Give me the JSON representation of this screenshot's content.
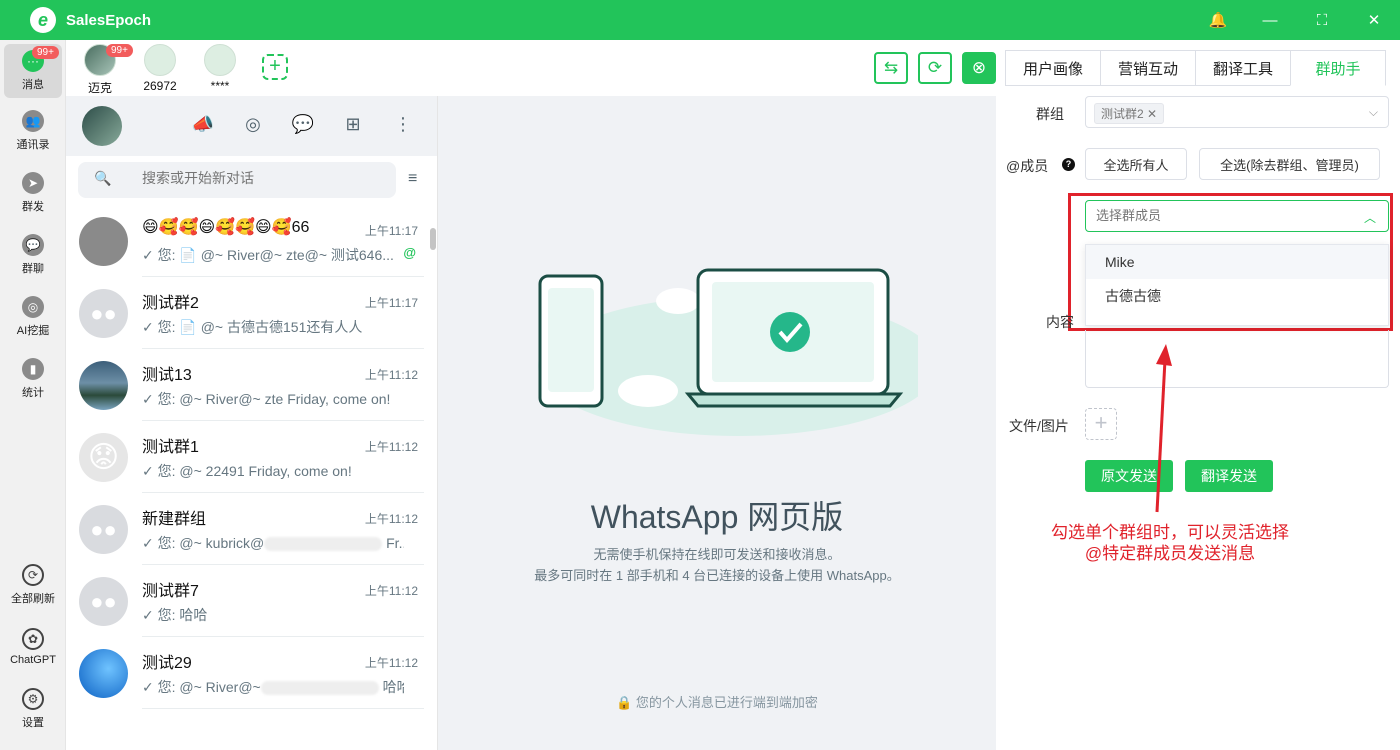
{
  "app": {
    "title": "SalesEpoch",
    "logo_letter": "e"
  },
  "window_controls": [
    "🔔",
    "—",
    "⛶",
    "✕"
  ],
  "leftnav": [
    {
      "name": "nav-messages",
      "label": "消息",
      "icon": "···",
      "badge": "99+",
      "active": true
    },
    {
      "name": "nav-contacts",
      "label": "通讯录",
      "icon": "👥"
    },
    {
      "name": "nav-broadcast",
      "label": "群发",
      "icon": "➤"
    },
    {
      "name": "nav-groupchat",
      "label": "群聊",
      "icon": "💬"
    },
    {
      "name": "nav-ai-mining",
      "label": "AI挖掘",
      "icon": "◎"
    },
    {
      "name": "nav-stats",
      "label": "统计",
      "icon": "▮"
    },
    {
      "name": "nav-refresh-all",
      "label": "全部刷新",
      "icon": "⟳"
    },
    {
      "name": "nav-chatgpt",
      "label": "ChatGPT",
      "icon": "✿"
    },
    {
      "name": "nav-settings",
      "label": "设置",
      "icon": "⚙"
    }
  ],
  "accounts": [
    {
      "label": "迈克",
      "badge": "99+",
      "photo": true
    },
    {
      "label": "26972"
    },
    {
      "label": "****"
    }
  ],
  "add_account_symbol": "+",
  "toolbar": {
    "switch_icon": "⇆",
    "refresh_icon": "⟳",
    "close_icon": "⊗"
  },
  "chat_header_icons": [
    "📣",
    "◎",
    "💬",
    "⊞",
    "⋮"
  ],
  "search": {
    "placeholder": "搜索或开始新对话",
    "icon": "🔍",
    "filter_icon": "≡"
  },
  "chats": [
    {
      "name": "😄🥰🥰😄🥰🥰😄🥰66",
      "time": "上午11:17",
      "msg": "✓ 您: 📄 @~ River@~ zte@~ 测试646...",
      "at": "@",
      "avatar": "gray"
    },
    {
      "name": "测试群2",
      "time": "上午11:17",
      "msg": "✓ 您: 📄 @~ 古德古德151还有人人",
      "avatar": "group"
    },
    {
      "name": "测试13",
      "time": "上午11:12",
      "msg": "✓ 您: @~ River@~ zte Friday, come on!",
      "avatar": "lake"
    },
    {
      "name": "测试群1",
      "time": "上午11:12",
      "msg": "✓ 您: @~ 22491 Friday, come on!",
      "avatar": "emoji"
    },
    {
      "name": "新建群组",
      "time": "上午11:12",
      "msg_prefix": "✓ 您: @~ kubrick@",
      "msg_suffix": "Fr...",
      "avatar": "group",
      "blur": true
    },
    {
      "name": "测试群7",
      "time": "上午11:12",
      "msg": "✓ 您: 哈哈",
      "avatar": "group"
    },
    {
      "name": "测试29",
      "time": "上午11:12",
      "msg_prefix": "✓ 您: @~ River@~",
      "msg_suffix": "哈哈",
      "avatar": "win",
      "blur": true
    }
  ],
  "center": {
    "title": "WhatsApp 网页版",
    "desc_line1": "无需使手机保持在线即可发送和接收消息。",
    "desc_line2": "最多可同时在 1 部手机和 4 台已连接的设备上使用 WhatsApp。",
    "encryption": "🔒 您的个人消息已进行端到端加密"
  },
  "right": {
    "tabs": [
      "用户画像",
      "营销互动",
      "翻译工具",
      "群助手"
    ],
    "active_tab": 3,
    "group_label": "群组",
    "group_tag": "测试群2",
    "members_label": "@成员",
    "help": "?",
    "select_all": "全选所有人",
    "select_all_excl": "全选(除去群组、管理员)",
    "member_placeholder": "选择群成员",
    "member_options": [
      "Mike",
      "古德古德"
    ],
    "content_label": "内容",
    "file_label": "文件/图片",
    "upload_symbol": "+",
    "send_original": "原文发送",
    "send_translated": "翻译发送"
  },
  "annotation": {
    "line1": "勾选单个群组时，可以灵活选择",
    "line2": "@特定群成员发送消息"
  },
  "colors": {
    "brand": "#22c45a",
    "annotation": "#e0222b"
  }
}
